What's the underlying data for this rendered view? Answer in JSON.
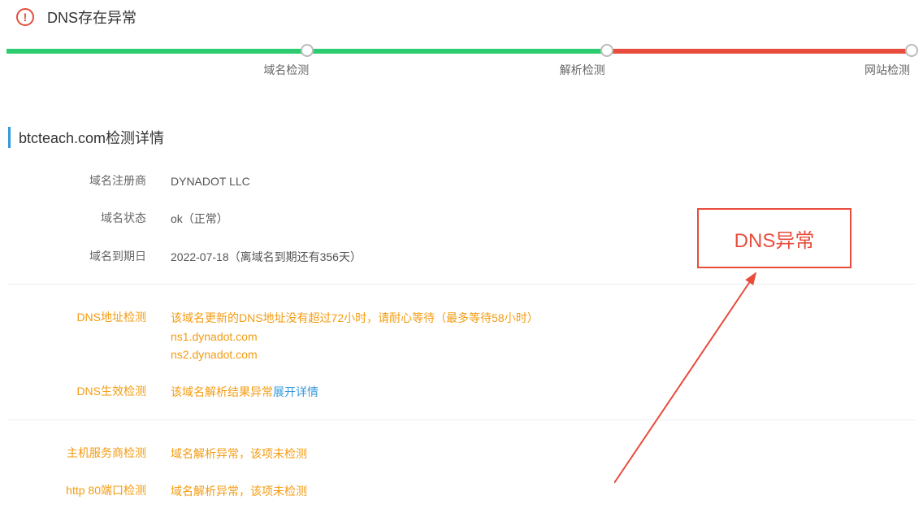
{
  "header": {
    "title": "DNS存在异常"
  },
  "progress": {
    "labels": [
      "域名检测",
      "解析检测",
      "网站检测"
    ]
  },
  "section": {
    "title": "btcteach.com检测详情"
  },
  "details": {
    "registrar": {
      "label": "域名注册商",
      "value": "DYNADOT LLC"
    },
    "status": {
      "label": "域名状态",
      "value": "ok（正常）"
    },
    "expiry": {
      "label": "域名到期日",
      "value": "2022-07-18（离域名到期还有356天）"
    },
    "dns_addr": {
      "label": "DNS地址检测",
      "msg": "该域名更新的DNS地址没有超过72小时，请耐心等待（最多等待58小时）",
      "ns1": "ns1.dynadot.com",
      "ns2": "ns2.dynadot.com"
    },
    "dns_effect": {
      "label": "DNS生效检测",
      "msg": "该域名解析结果异常",
      "link": "展开详情"
    },
    "host": {
      "label": "主机服务商检测",
      "msg": "域名解析异常，该项未检测"
    },
    "http80": {
      "label": "http 80端口检测",
      "msg": "域名解析异常，该项未检测"
    }
  },
  "annotation": {
    "text": "DNS异常"
  }
}
